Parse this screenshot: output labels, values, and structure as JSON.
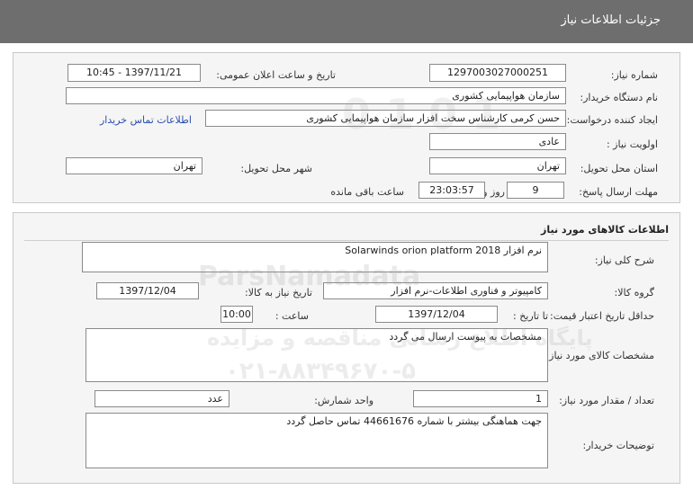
{
  "header": {
    "title": "جزئیات اطلاعات نیاز"
  },
  "need_info": {
    "need_number_label": "شماره نیاز:",
    "need_number": "1297003027000251",
    "announce_label": "تاریخ و ساعت اعلان عمومی:",
    "announce_value": "1397/11/21 - 10:45",
    "buyer_org_label": "نام دستگاه خریدار:",
    "buyer_org": "سازمان هواپیمایی کشوری",
    "requester_label": "ایجاد کننده درخواست:",
    "requester": "حسن کرمی کارشناس سخت افزار سازمان هواپیمایی کشوری",
    "contact_link": "اطلاعات تماس خریدار",
    "priority_label": "اولویت نیاز :",
    "priority": "عادی",
    "province_label": "استان محل تحویل:",
    "province": "تهران",
    "city_label": "شهر محل تحویل:",
    "city": "تهران",
    "deadline_label": "مهلت ارسال پاسخ:",
    "deadline_days": "9",
    "days_word": "روز و",
    "deadline_time": "23:03:57",
    "remaining_text": "ساعت باقی مانده"
  },
  "goods": {
    "section_title": "اطلاعات کالاهای مورد نیاز",
    "general_desc_label": "شرح کلی نیاز:",
    "general_desc": "نرم افزار Solarwinds orion platform 2018",
    "goods_group_label": "گروه کالا:",
    "goods_group": "کامپیوتر و فناوری اطلاعات-نرم افزار",
    "need_date_label": "تاریخ نیاز به کالا:",
    "need_date": "1397/12/04",
    "price_validity_label": "حداقل تاریخ اعتبار قیمت:",
    "until_date_label": "تا تاریخ :",
    "price_validity_date": "1397/12/04",
    "time_label": "ساعت :",
    "price_validity_time": "10:00",
    "specs_label": "مشخصات کالای مورد نیاز:",
    "specs": "مشخصات به پیوست ارسال می گردد",
    "quantity_label": "تعداد / مقدار مورد نیاز:",
    "quantity": "1",
    "unit_label": "واحد شمارش:",
    "unit": "عدد",
    "buyer_notes_label": "توضیحات خریدار:",
    "buyer_notes": "جهت هماهنگی بیشتر با شماره 44661676 تماس حاصل گردد"
  },
  "watermark": {
    "brand": "ParsNamadata",
    "line1": "پایگاه اطلاع رسانی مناقصه و مزایده",
    "phone": "۰۲۱-۸۸۳۴۹۶۷۰-۵",
    "number": "1 0 1 0"
  },
  "colors": {
    "title_bar": "#6e6e6e",
    "panel": "#f5f5f5",
    "link": "#2a4fb0"
  }
}
